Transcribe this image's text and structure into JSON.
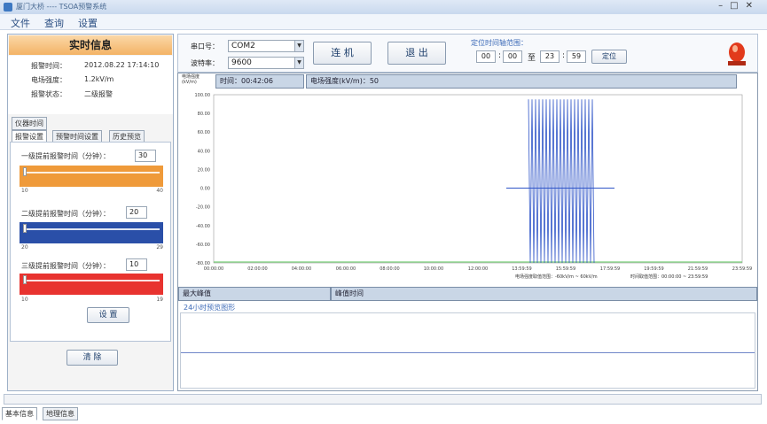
{
  "window": {
    "title": "厦门大桥 ---- TSOA预警系统"
  },
  "menu": [
    "文件",
    "查询",
    "设置"
  ],
  "realtime": {
    "title": "实时信息",
    "rows": [
      {
        "label": "报警时间：",
        "value": "2012.08.22 17:14:10"
      },
      {
        "label": "电场强度：",
        "value": "1.2kV/m"
      },
      {
        "label": "报警状态：",
        "value": "二级报警"
      }
    ]
  },
  "tabs": {
    "top": "仪器时间",
    "items": [
      "报警设置",
      "预警时间设置",
      "历史预览"
    ]
  },
  "sliders": [
    {
      "label": "一级提前报警时间（分钟）：",
      "value": "30",
      "min": "10",
      "max": "40",
      "color": "#ef9a3a"
    },
    {
      "label": "二级提前报警时间（分钟）：",
      "value": "20",
      "min": "20",
      "max": "29",
      "color": "#2a4fa8"
    },
    {
      "label": "三级提前报警时间（分钟）：",
      "value": "10",
      "min": "10",
      "max": "19",
      "color": "#e8332f"
    }
  ],
  "buttons": {
    "settings": "设 置",
    "clear": "清 除",
    "connect": "连 机",
    "exit": "退 出",
    "locate": "定位"
  },
  "serial": {
    "port_label": "串口号：",
    "port_value": "COM2",
    "baud_label": "波特率：",
    "baud_value": "9600"
  },
  "time_range": {
    "title": "定位时间轴范围：",
    "start_h": "00",
    "start_m": "00",
    "to": "至",
    "end_h": "23",
    "end_m": "59",
    "sep": ":"
  },
  "chart": {
    "corner_label": "电场强度\n(kV/m)",
    "time_header": "时间：00:42:06",
    "field_header": "电场强度(kV/m)：50",
    "x_axis_note_1": "电场强度取值范围：-60kV/m ~ 60kV/m",
    "x_axis_note_2": "时间取值范围：00:00:00 ~ 23:59:59"
  },
  "chart_data": {
    "type": "line",
    "y_ticks": [
      "100.00",
      "80.00",
      "60.00",
      "40.00",
      "20.00",
      "0.00",
      "-20.00",
      "-40.00",
      "-60.00",
      "-80.00"
    ],
    "x_ticks": [
      "00:00:00",
      "02:00:00",
      "04:00:00",
      "06:00:00",
      "08:00:00",
      "10:00:00",
      "12:00:00",
      "13:59:59",
      "15:59:59",
      "17:59:59",
      "19:59:59",
      "21:59:59",
      "23:59:59"
    ],
    "ylim": [
      -80,
      100
    ],
    "grid": true
  },
  "lower": {
    "max_header": "最大峰值",
    "peak_time_header": "峰值时间",
    "preview_title": "24小时预览图形"
  },
  "bottom_tabs": [
    "基本信息",
    "地理信息"
  ],
  "colors": {
    "accent": "#f3b365",
    "grid": "#7ad07a",
    "wave": "#2f55c8"
  }
}
